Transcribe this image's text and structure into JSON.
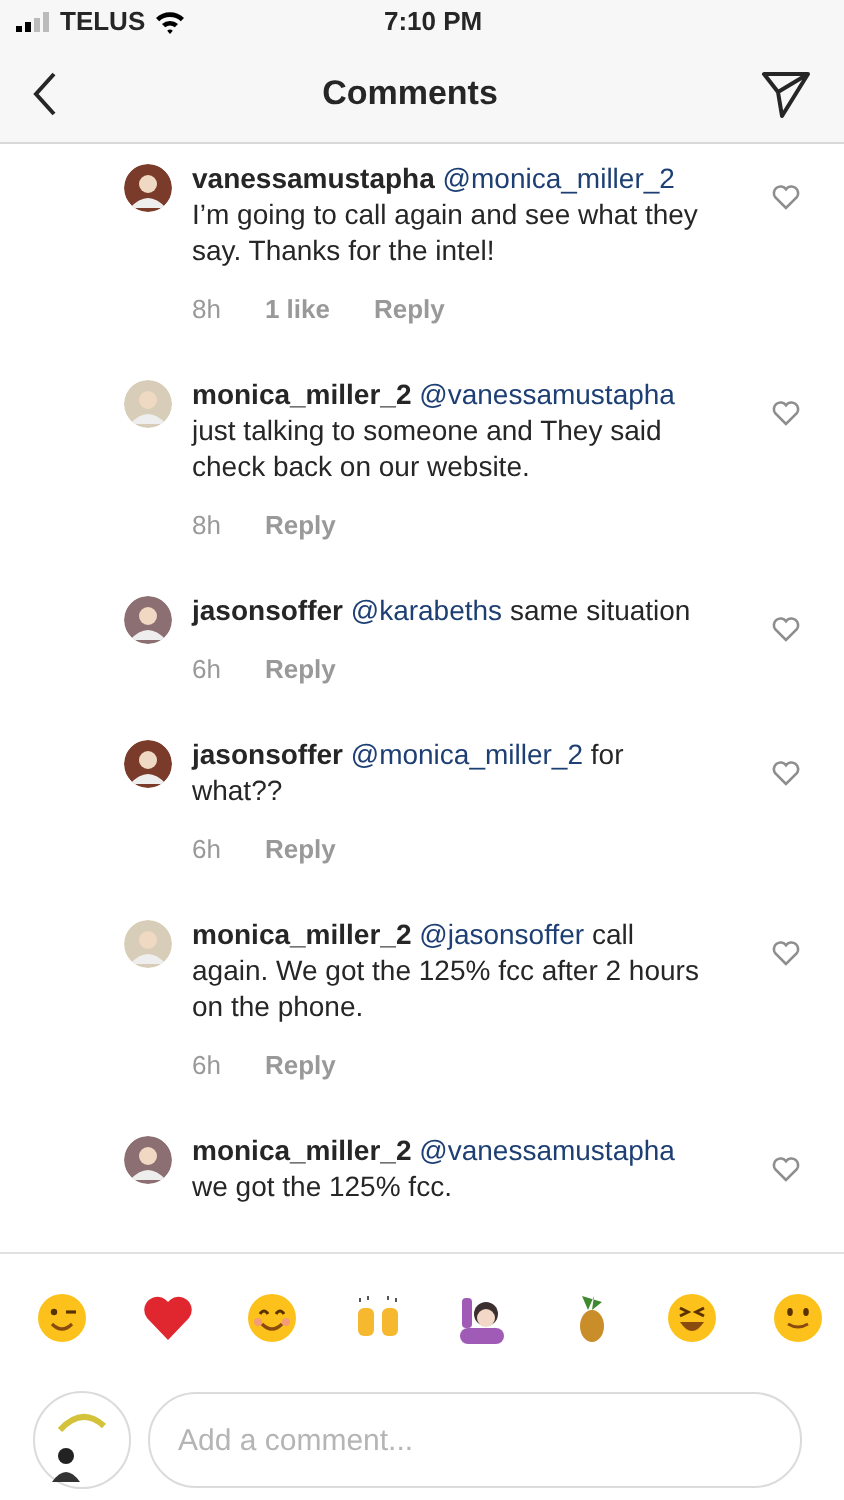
{
  "status_bar": {
    "carrier": "TELUS",
    "time": "7:10 PM"
  },
  "header": {
    "title": "Comments"
  },
  "comments": [
    {
      "user": "vanessamustapha",
      "mention": "@monica_miller_2",
      "text": "I’m going to call again and see what they say.  Thanks for the intel!",
      "time": "8h",
      "likes": "1 like",
      "reply": "Reply"
    },
    {
      "user": "monica_miller_2",
      "mention": "@vanessamustapha",
      "text": "just talking to someone and They said check back on our website.",
      "time": "8h",
      "reply": "Reply"
    },
    {
      "user": "jasonsoffer",
      "mention": "@karabeths",
      "text": "same situation",
      "time": "6h",
      "reply": "Reply"
    },
    {
      "user": "jasonsoffer",
      "mention": "@monica_miller_2",
      "text": "for what??",
      "time": "6h",
      "reply": "Reply"
    },
    {
      "user": "monica_miller_2",
      "mention": "@jasonsoffer",
      "text": "call again. We got the 125% fcc after 2 hours on the phone.",
      "time": "6h",
      "reply": "Reply"
    },
    {
      "user": "monica_miller_2",
      "mention": "@vanessamustapha",
      "text": "we got the 125% fcc."
    }
  ],
  "emoji_bar": [
    {
      "kind": "wink"
    },
    {
      "kind": "heart"
    },
    {
      "kind": "smile"
    },
    {
      "kind": "raised-hands"
    },
    {
      "kind": "person-raising-hand"
    },
    {
      "kind": "pineapple"
    },
    {
      "kind": "laugh"
    },
    {
      "kind": "slight-smile"
    }
  ],
  "composer": {
    "placeholder": "Add a comment..."
  }
}
